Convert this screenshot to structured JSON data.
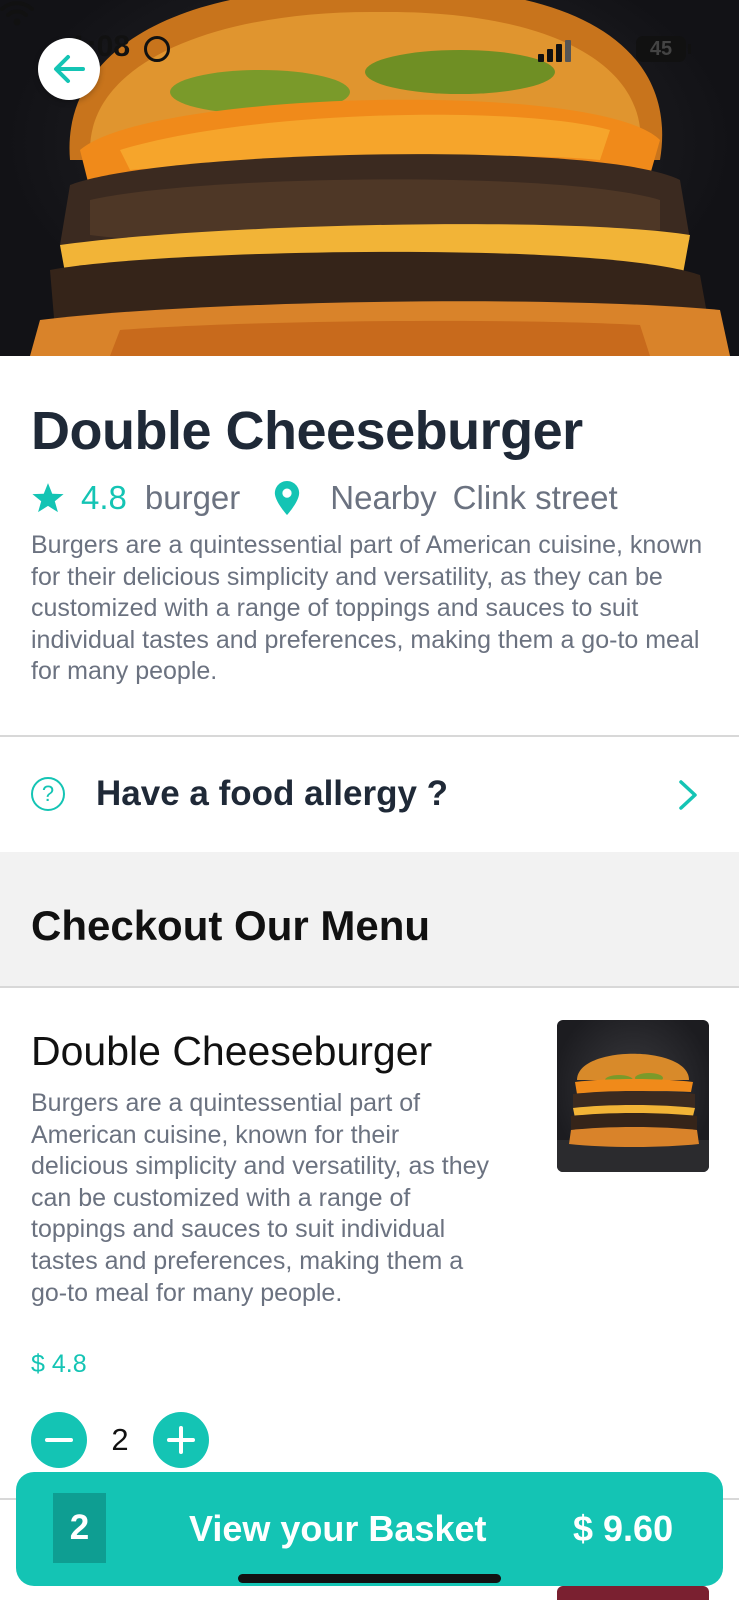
{
  "status_bar": {
    "time": "1:08",
    "battery": "45"
  },
  "hero": {
    "image": "double-cheeseburger-photo"
  },
  "product": {
    "title": "Double Cheeseburger",
    "rating": "4.8",
    "category": "burger",
    "distance": "Nearby",
    "location": "Clink street",
    "description": "Burgers are a quintessential part of American cuisine, known for their delicious simplicity and versatility, as they can be customized with a range of toppings and sauces to suit individual tastes and preferences, making them a go-to meal for many people."
  },
  "allergy": {
    "label": "Have a food allergy ?",
    "icon": "question-circle-icon"
  },
  "menu": {
    "heading": "Checkout Our Menu",
    "items": [
      {
        "title": "Double Cheeseburger",
        "description": "Burgers are a quintessential part of American cuisine, known for their delicious simplicity and versatility, as they can be customized with a range of toppings and sauces to suit individual tastes and preferences, making them a go-to meal for many people.",
        "price": "$ 4.8",
        "quantity": "2"
      }
    ]
  },
  "basket": {
    "count": "2",
    "label": "View your Basket",
    "total": "$ 9.60"
  },
  "colors": {
    "accent": "#14c4b4",
    "accent_dark": "#0e9e92",
    "title_text": "#1f2937",
    "muted_text": "#6b7280",
    "section_bg": "#f2f2f2"
  }
}
